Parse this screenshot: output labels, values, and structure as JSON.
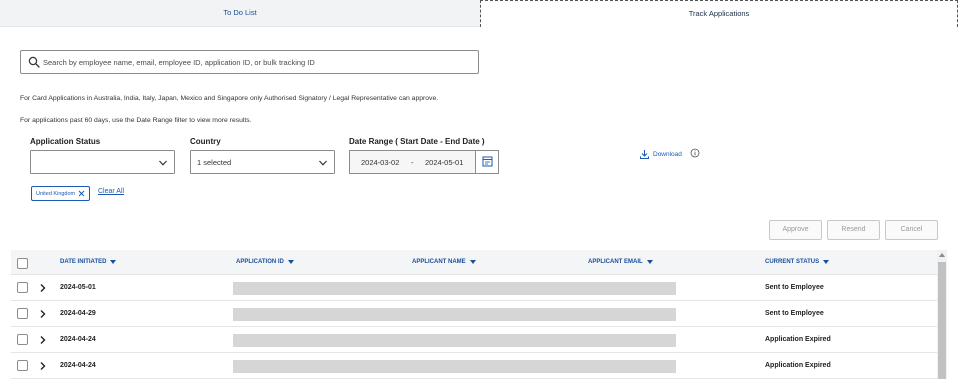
{
  "tabs": [
    {
      "label": "To Do List",
      "active": false
    },
    {
      "label": "Track Applications",
      "active": true
    }
  ],
  "search": {
    "placeholder": "Search by employee name, email, employee ID, application ID, or bulk tracking ID",
    "value": "",
    "icon": "search-icon"
  },
  "notes": {
    "approval": "For Card Applications in Australia, India, Italy, Japan, Mexico and Singapore only Authorised Signatory / Legal Representative can approve.",
    "date_range": "For applications past 60 days, use the Date Range filter to view more results."
  },
  "filters": {
    "application_status": {
      "label": "Application Status",
      "value": ""
    },
    "country": {
      "label": "Country",
      "value": "1 selected"
    },
    "date_range": {
      "label": "Date Range ( Start Date - End Date )",
      "start": "2024-03-02",
      "separator": "-",
      "end": "2024-05-01"
    }
  },
  "download": {
    "label": "Download",
    "icon": "download-icon"
  },
  "chips": [
    {
      "label": "United Kingdom"
    }
  ],
  "clear_all": "Clear All",
  "actions": {
    "approve": "Approve",
    "resend": "Resend",
    "cancel": "Cancel"
  },
  "table": {
    "columns": [
      "DATE INITIATED",
      "APPLICATION ID",
      "APPLICANT NAME",
      "APPLICANT EMAIL",
      "CURRENT STATUS"
    ],
    "rows": [
      {
        "date": "2024-05-01",
        "status": "Sent to Employee"
      },
      {
        "date": "2024-04-29",
        "status": "Sent to Employee"
      },
      {
        "date": "2024-04-24",
        "status": "Application Expired"
      },
      {
        "date": "2024-04-24",
        "status": "Application Expired"
      }
    ]
  },
  "colors": {
    "accent": "#1a5bb5",
    "header_text": "#1a4f9c",
    "redaction": "#d6d6d6"
  }
}
